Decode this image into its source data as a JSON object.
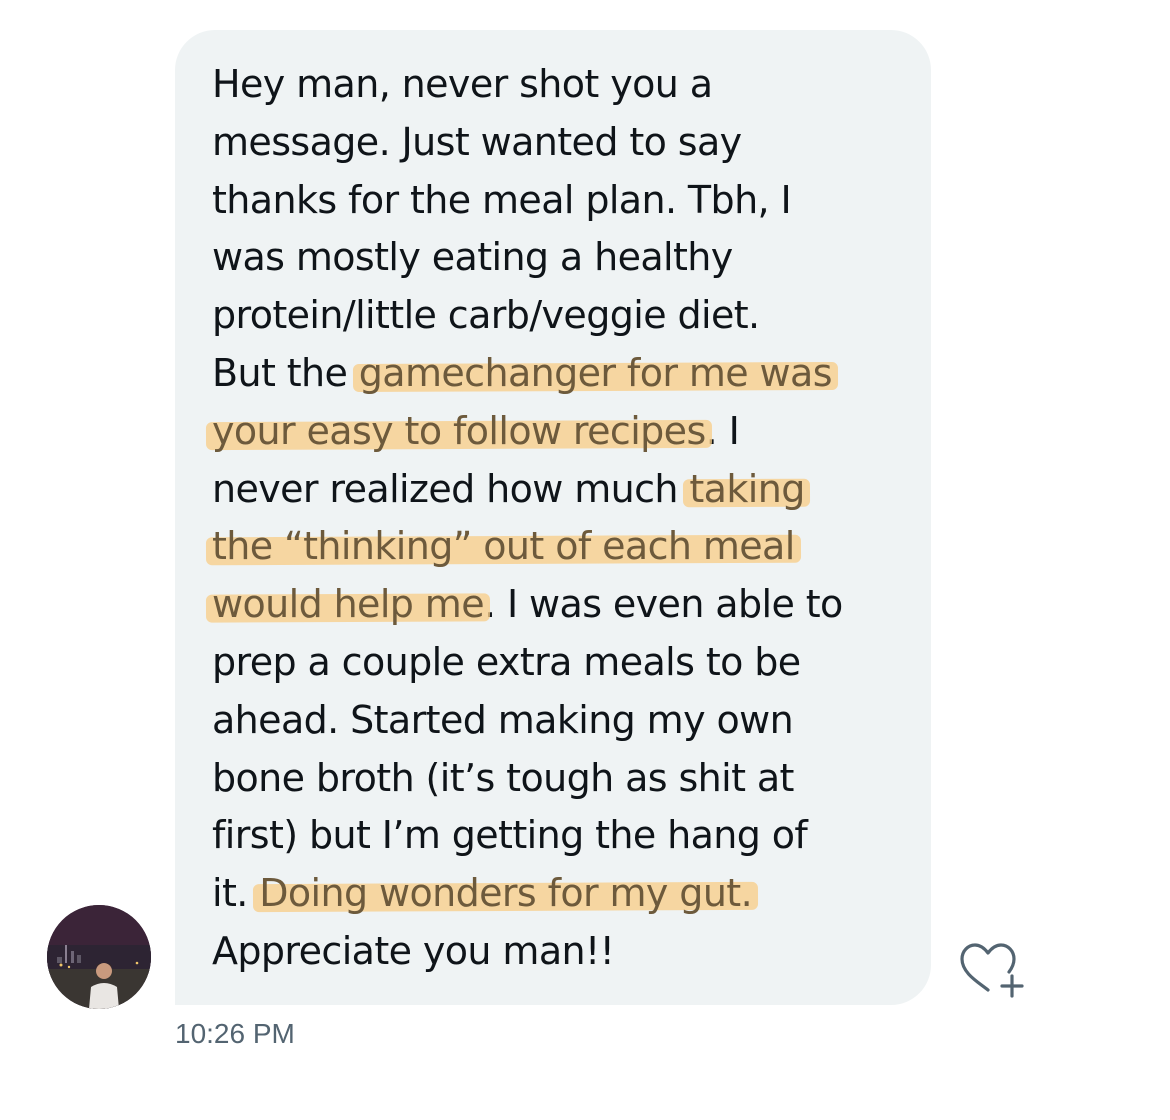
{
  "message": {
    "lines": [
      [
        {
          "text": "Hey man, never shot you a",
          "hl": false
        }
      ],
      [
        {
          "text": "message. Just wanted to say",
          "hl": false
        }
      ],
      [
        {
          "text": "thanks for the meal plan. Tbh, I",
          "hl": false
        }
      ],
      [
        {
          "text": "was mostly eating a healthy",
          "hl": false
        }
      ],
      [
        {
          "text": "protein/little carb/veggie diet.",
          "hl": false
        }
      ],
      [
        {
          "text": "But the ",
          "hl": false
        },
        {
          "text": "gamechanger for me was",
          "hl": true
        }
      ],
      [
        {
          "text": "your easy to follow recipes",
          "hl": true
        },
        {
          "text": ". I",
          "hl": false
        }
      ],
      [
        {
          "text": "never realized how much ",
          "hl": false
        },
        {
          "text": "taking",
          "hl": true
        }
      ],
      [
        {
          "text": "the “thinking” out of each meal",
          "hl": true
        }
      ],
      [
        {
          "text": "would help me",
          "hl": true
        },
        {
          "text": ". I was even able to",
          "hl": false
        }
      ],
      [
        {
          "text": "prep a couple extra meals to be",
          "hl": false
        }
      ],
      [
        {
          "text": "ahead. Started making my own",
          "hl": false
        }
      ],
      [
        {
          "text": "bone broth (it’s tough as shit at",
          "hl": false
        }
      ],
      [
        {
          "text": "first) but I’m getting the hang of",
          "hl": false
        }
      ],
      [
        {
          "text": "it. ",
          "hl": false
        },
        {
          "text": "Doing wonders for my gut.",
          "hl": true
        }
      ],
      [
        {
          "text": "Appreciate you man!!",
          "hl": false
        }
      ]
    ],
    "timestamp": "10:26 PM"
  },
  "icons": {
    "react": "heart-plus-icon",
    "avatar": "avatar"
  },
  "colors": {
    "bubble": "#eff3f4",
    "text": "#0f1419",
    "highlight": "#f7cd89",
    "highlight_text": "#6d5a3c",
    "timestamp": "#536471",
    "icon": "#536471"
  }
}
